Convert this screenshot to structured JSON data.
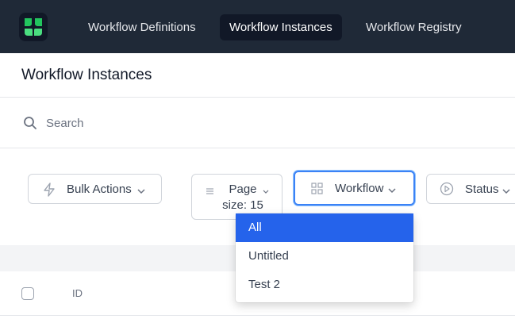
{
  "nav": {
    "tabs": [
      {
        "label": "Workflow Definitions",
        "active": false
      },
      {
        "label": "Workflow Instances",
        "active": true
      },
      {
        "label": "Workflow Registry",
        "active": false
      }
    ]
  },
  "page": {
    "title": "Workflow Instances"
  },
  "search": {
    "placeholder": "Search",
    "value": ""
  },
  "toolbar": {
    "bulk_actions_label": "Bulk Actions",
    "page_size_label": "Page size: 15",
    "workflow_label": "Workflow",
    "status_label": "Status"
  },
  "workflow_dropdown": {
    "options": [
      "All",
      "Untitled",
      "Test 2"
    ],
    "selected": "All"
  },
  "table": {
    "columns": [
      "ID"
    ]
  },
  "colors": {
    "nav_bg": "#1f2937",
    "accent": "#2563eb",
    "logo_green": "#22c55e"
  },
  "icons": [
    "logo-icon",
    "search-icon",
    "lightning-icon",
    "chevron-down-icon",
    "list-icon",
    "grid-icon",
    "play-circle-icon"
  ]
}
